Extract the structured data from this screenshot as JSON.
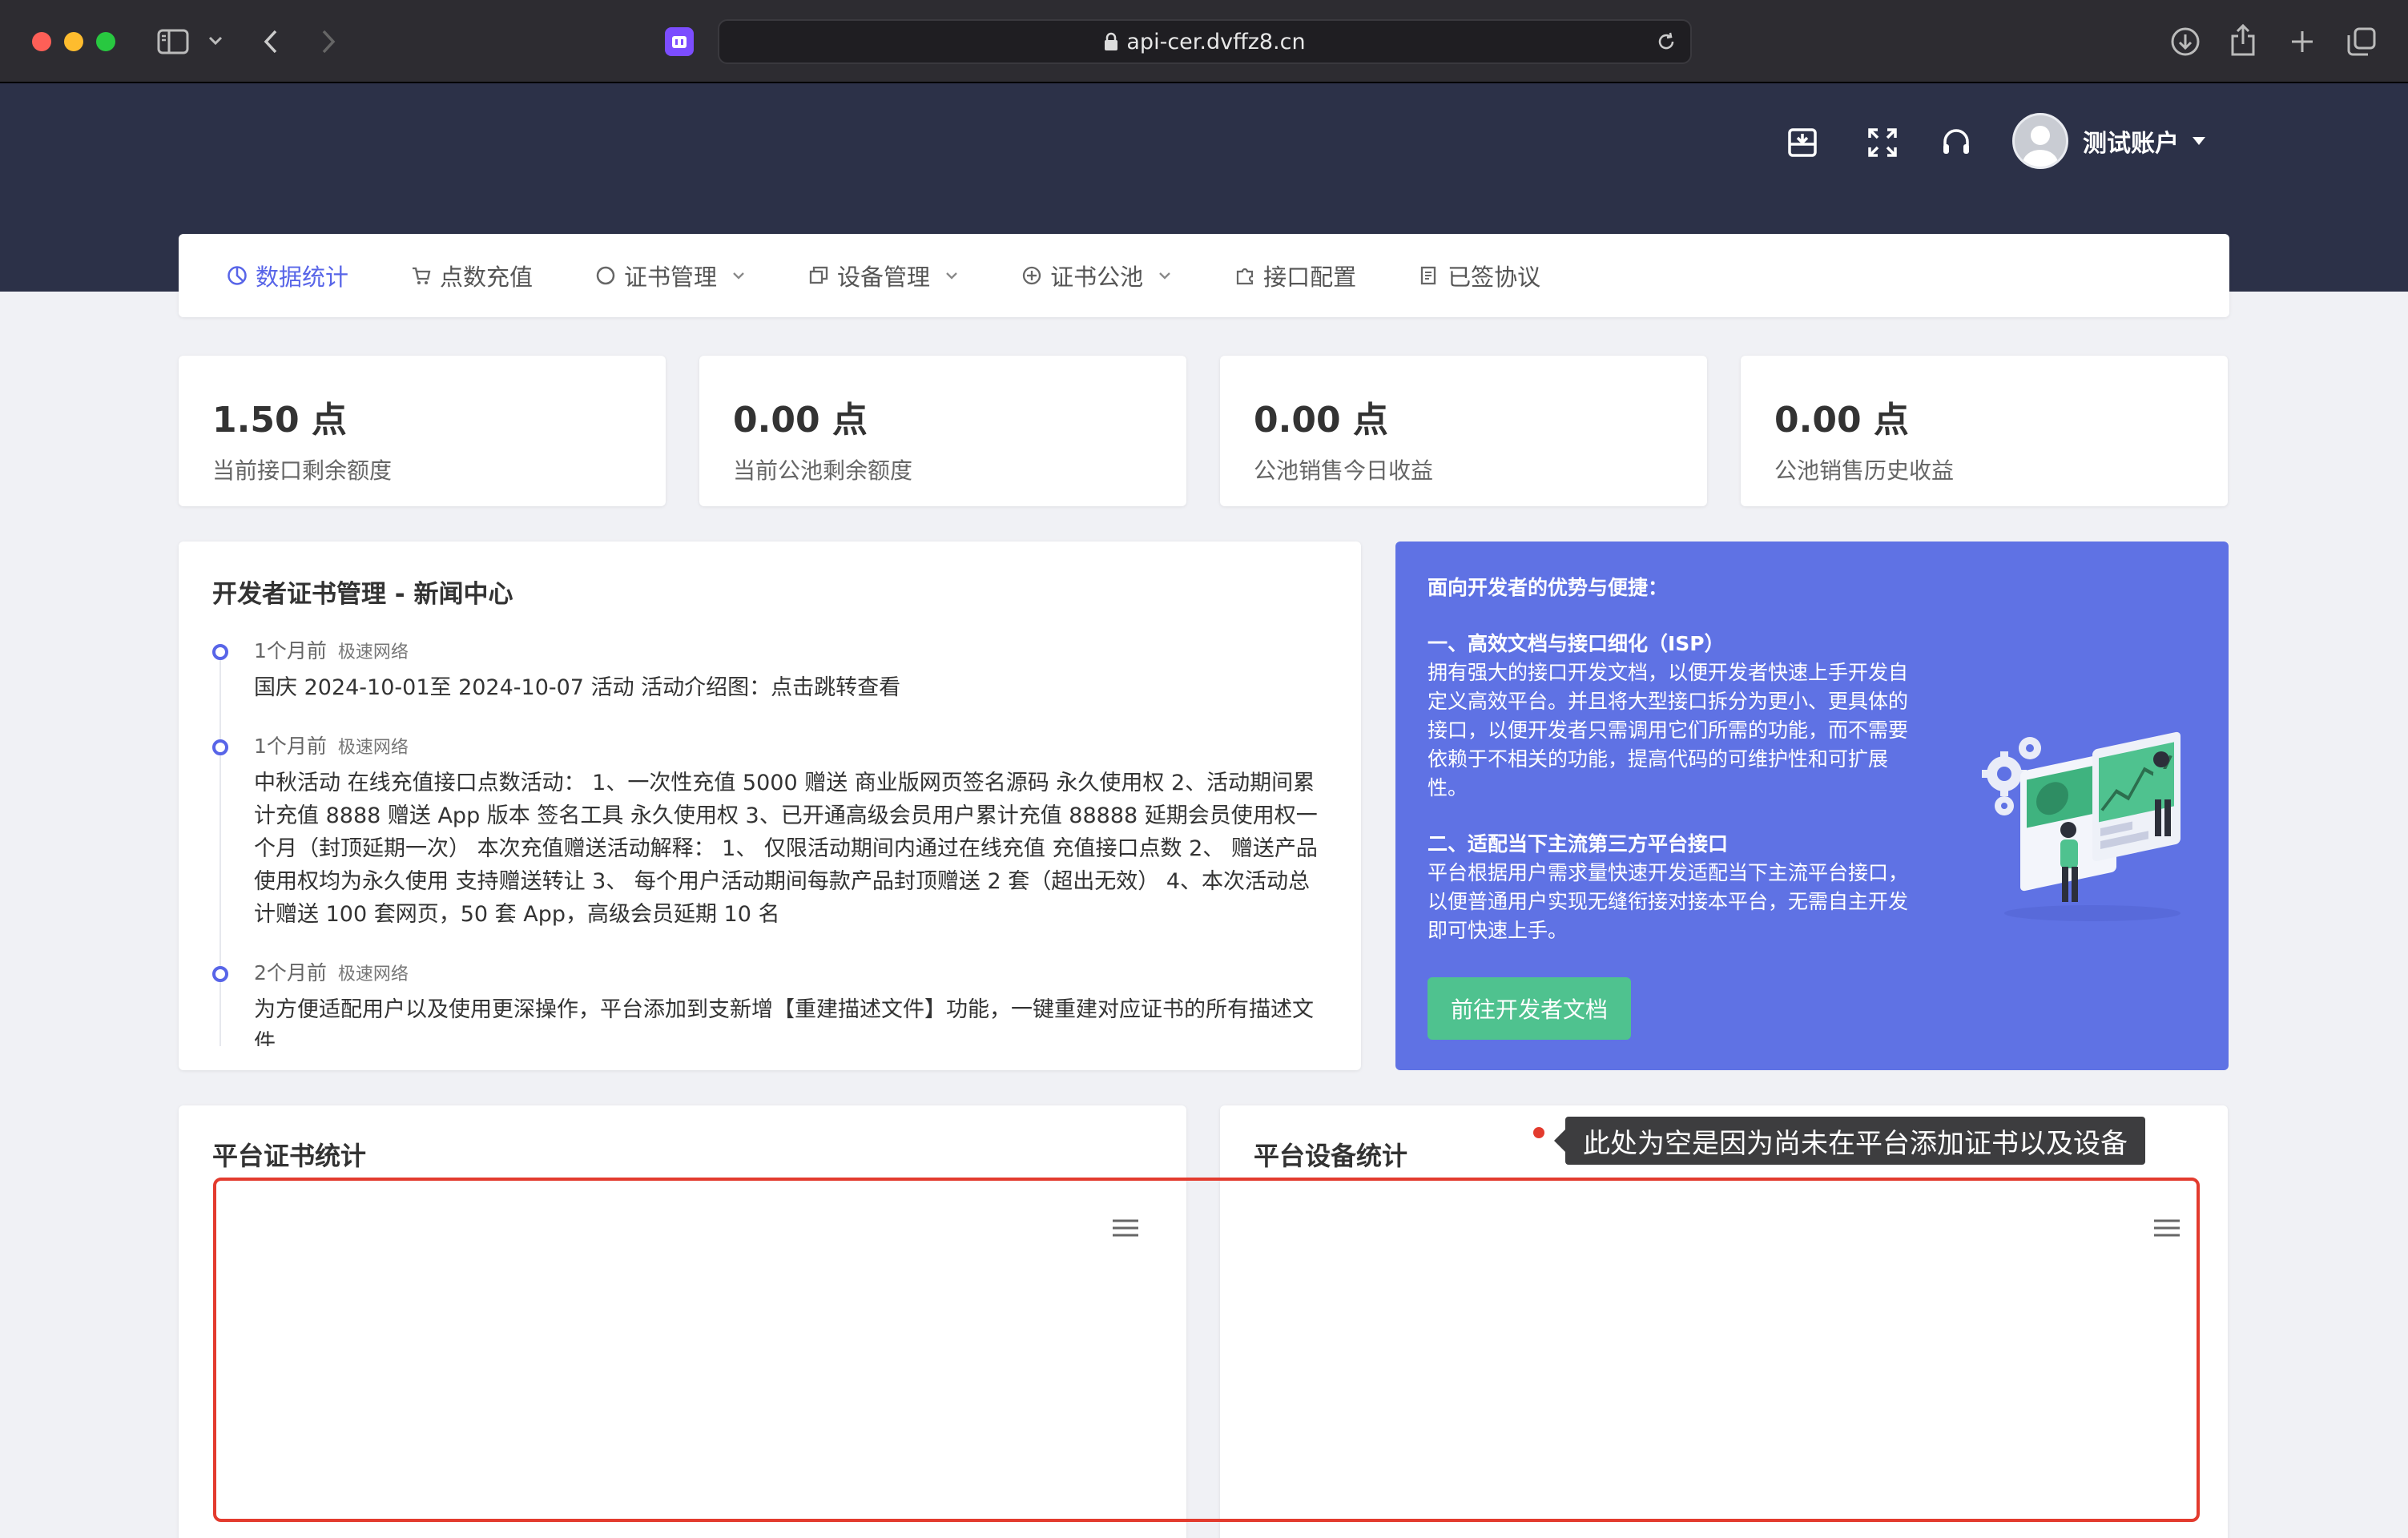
{
  "browser": {
    "url": "api-cer.dvffz8.cn"
  },
  "header": {
    "username": "测试账户"
  },
  "nav": {
    "items": [
      {
        "label": "数据统计",
        "icon": "pie-chart-icon",
        "active": true,
        "dropdown": false
      },
      {
        "label": "点数充值",
        "icon": "cart-icon",
        "active": false,
        "dropdown": false
      },
      {
        "label": "证书管理",
        "icon": "circle-icon",
        "active": false,
        "dropdown": true
      },
      {
        "label": "设备管理",
        "icon": "devices-icon",
        "active": false,
        "dropdown": true
      },
      {
        "label": "证书公池",
        "icon": "plus-circle-icon",
        "active": false,
        "dropdown": true
      },
      {
        "label": "接口配置",
        "icon": "puzzle-icon",
        "active": false,
        "dropdown": false
      },
      {
        "label": "已签协议",
        "icon": "document-icon",
        "active": false,
        "dropdown": false
      }
    ]
  },
  "stats": [
    {
      "value": "1.50 点",
      "label": "当前接口剩余额度"
    },
    {
      "value": "0.00 点",
      "label": "当前公池剩余额度"
    },
    {
      "value": "0.00 点",
      "label": "公池销售今日收益"
    },
    {
      "value": "0.00 点",
      "label": "公池销售历史收益"
    }
  ],
  "news": {
    "title": "开发者证书管理 - 新闻中心",
    "items": [
      {
        "time": "1个月前",
        "source": "极速网络",
        "text": "国庆 2024-10-01至 2024-10-07 活动 活动介绍图：点击跳转查看"
      },
      {
        "time": "1个月前",
        "source": "极速网络",
        "text": "中秋活动 在线充值接口点数活动： 1、一次性充值 5000 赠送 商业版网页签名源码 永久使用权 2、活动期间累计充值 8888 赠送 App 版本 签名工具 永久使用权 3、已开通高级会员用户累计充值 88888 延期会员使用权一个月（封顶延期一次） 本次充值赠送活动解释： 1、 仅限活动期间内通过在线充值 充值接口点数 2、 赠送产品使用权均为永久使用 支持赠送转让 3、 每个用户活动期间每款产品封顶赠送 2 套（超出无效） 4、本次活动总计赠送 100 套网页，50 套 App，高级会员延期 10 名"
      },
      {
        "time": "2个月前",
        "source": "极速网络",
        "text": "为方便适配用户以及使用更深操作，平台添加到支新增【重建描述文件】功能，一键重建对应证书的所有描述文件"
      }
    ]
  },
  "promo": {
    "heading": "面向开发者的优势与便捷：",
    "section1_title": "一、高效文档与接口细化（ISP）",
    "section1_text": "拥有强大的接口开发文档，以便开发者快速上手开发自定义高效平台。并且将大型接口拆分为更小、更具体的接口，以便开发者只需调用它们所需的功能，而不需要依赖于不相关的功能，提高代码的可维护性和可扩展性。",
    "section2_title": "二、适配当下主流第三方平台接口",
    "section2_text": "平台根据用户需求量快速开发适配当下主流平台接口，以便普通用户实现无缝衔接对接本平台，无需自主开发即可快速上手。",
    "button": "前往开发者文档"
  },
  "panels": {
    "cert_title": "平台证书统计",
    "device_title": "平台设备统计"
  },
  "annotation": {
    "tooltip": "此处为空是因为尚未在平台添加证书以及设备"
  },
  "colors": {
    "header_bg": "#2c3148",
    "accent": "#5865e8",
    "promo_bg": "#5f72e4",
    "button_green": "#4fc28f",
    "annotation_red": "#e33b2e"
  }
}
